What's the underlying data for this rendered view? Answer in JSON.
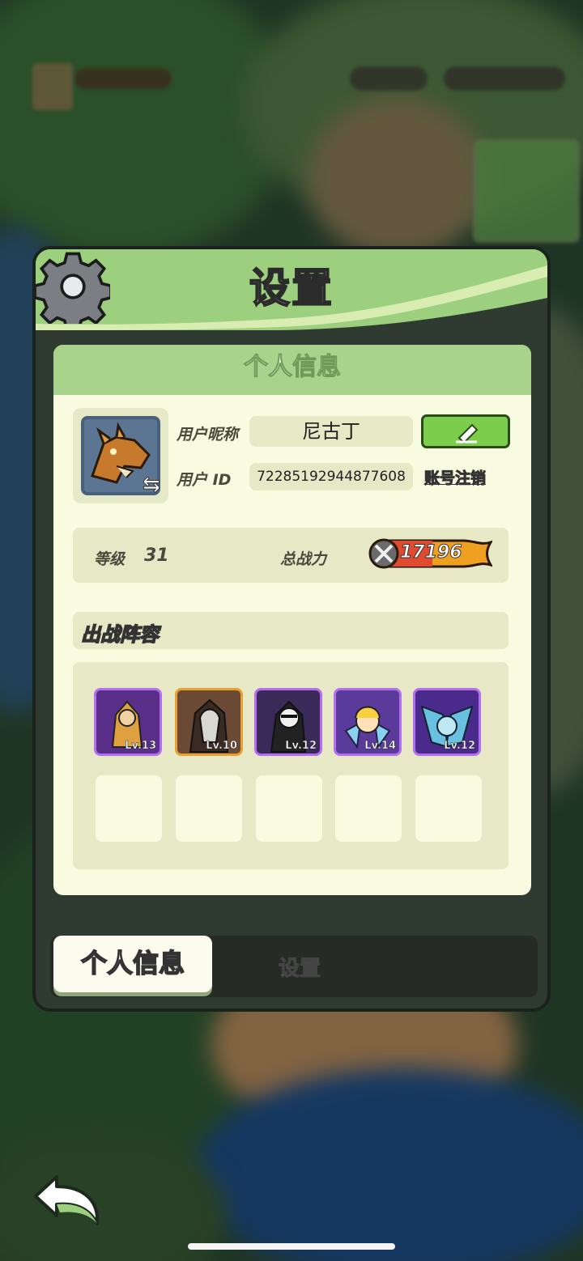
{
  "dialog": {
    "title": "设置",
    "panel_header": "个人信息",
    "profile": {
      "nickname_label": "用户昵称",
      "nickname": "尼古丁",
      "id_label": "用户 ID",
      "user_id": "72285192944877608",
      "cancel_account": "账号注销",
      "edit_icon": "pencil-icon",
      "swap_icon": "swap-arrows-icon"
    },
    "stats": {
      "level_label": "等级",
      "level": "31",
      "power_label": "总战力",
      "power": "17196"
    },
    "lineup": {
      "title": "出战阵容",
      "heroes": [
        {
          "level": "Lv.13",
          "rarity_color": "#a056e0"
        },
        {
          "level": "Lv.10",
          "rarity_color": "#e0a030"
        },
        {
          "level": "Lv.12",
          "rarity_color": "#a056e0"
        },
        {
          "level": "Lv.14",
          "rarity_color": "#a056e0"
        },
        {
          "level": "Lv.12",
          "rarity_color": "#a056e0"
        }
      ],
      "empty_slots": 5
    },
    "tabs": [
      {
        "label": "个人信息",
        "active": true
      },
      {
        "label": "设置",
        "active": false
      }
    ]
  },
  "colors": {
    "header_green": "#9ccf7e",
    "panel_bg": "#f8fbe0",
    "edit_green": "#7ccd4b"
  }
}
